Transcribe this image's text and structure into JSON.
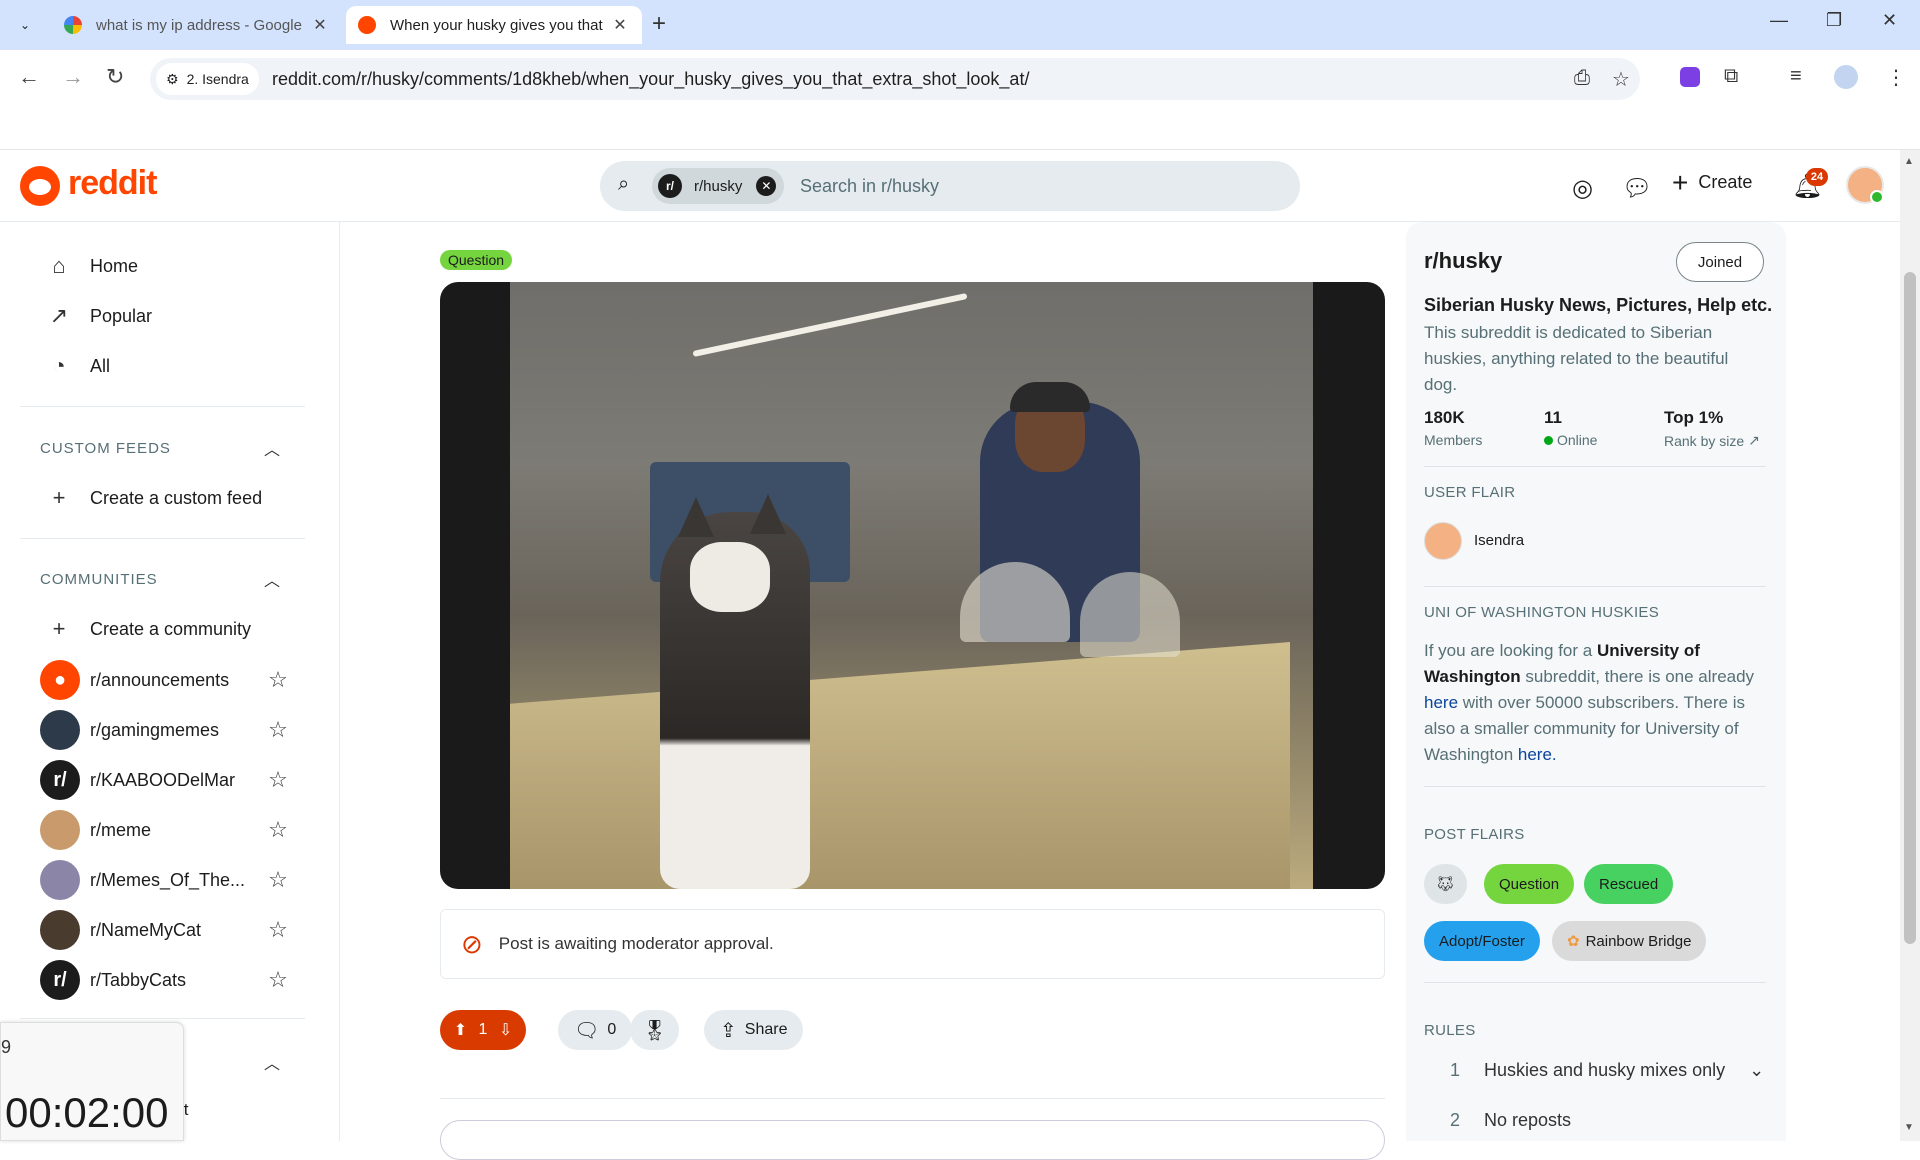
{
  "browser": {
    "tabs": [
      {
        "title": "what is my ip address - Google",
        "active": false,
        "favicon_color": "#4285f4"
      },
      {
        "title": "When your husky gives you that",
        "active": true,
        "favicon_color": "#ff4500"
      }
    ],
    "site_chip": "2. Isendra",
    "url": "reddit.com/r/husky/comments/1d8kheb/when_your_husky_gives_you_that_extra_shot_look_at/"
  },
  "header": {
    "logo_text": "reddit",
    "search_chip": "r/husky",
    "search_placeholder": "Search in r/husky",
    "create_label": "Create",
    "notification_count": "24"
  },
  "left_nav": {
    "items": [
      {
        "label": "Home",
        "icon": "home-icon"
      },
      {
        "label": "Popular",
        "icon": "popular-icon"
      },
      {
        "label": "All",
        "icon": "all-icon"
      }
    ],
    "custom_feeds_title": "CUSTOM FEEDS",
    "create_feed": "Create a custom feed",
    "communities_title": "COMMUNITIES",
    "create_community": "Create a community",
    "communities": [
      {
        "name": "r/announcements",
        "color": "#ff4500"
      },
      {
        "name": "r/gamingmemes",
        "color": "#2d3a4a"
      },
      {
        "name": "r/KAABOODelMar",
        "color": "#1c1c1c"
      },
      {
        "name": "r/meme",
        "color": "#c99a6b"
      },
      {
        "name": "r/Memes_Of_The...",
        "color": "#8b86a8"
      },
      {
        "name": "r/NameMyCat",
        "color": "#4a3b2f"
      },
      {
        "name": "r/TabbyCats",
        "color": "#1c1c1c"
      }
    ],
    "partial_item": "it"
  },
  "timer": {
    "label": "9",
    "value": "00:02:00"
  },
  "post": {
    "flair": "Question",
    "moderation_notice": "Post is awaiting moderator approval.",
    "score": "1",
    "comments": "0",
    "share_label": "Share"
  },
  "sidebar": {
    "subreddit": "r/husky",
    "joined_label": "Joined",
    "tagline": "Siberian Husky News, Pictures, Help etc.",
    "description": "This subreddit is dedicated to Siberian huskies, anything related to the beautiful dog.",
    "stats": [
      {
        "value": "180K",
        "label": "Members"
      },
      {
        "value": "11",
        "label": "Online"
      },
      {
        "value": "Top 1%",
        "label": "Rank by size"
      }
    ],
    "user_flair_title": "USER FLAIR",
    "user_flair_name": "Isendra",
    "uw_title": "UNI OF WASHINGTON HUSKIES",
    "uw_text_1": "If you are looking for a ",
    "uw_bold": "University of Washington",
    "uw_text_2": " subreddit, there is one already ",
    "uw_link1": "here",
    "uw_text_3": " with over 50000 subscribers. There is also a smaller community for University of Washington ",
    "uw_link2": "here.",
    "post_flairs_title": "POST FLAIRS",
    "post_flairs": [
      {
        "label": "Question",
        "color": "#75d53f"
      },
      {
        "label": "Rescued",
        "color": "#46d160"
      },
      {
        "label": "Adopt/Foster",
        "color": "#24a0ed"
      },
      {
        "label": "Rainbow Bridge",
        "color": "#dadada"
      }
    ],
    "rules_title": "RULES",
    "rules": [
      {
        "n": "1",
        "text": "Huskies and husky mixes only"
      },
      {
        "n": "2",
        "text": "No reposts"
      }
    ]
  }
}
